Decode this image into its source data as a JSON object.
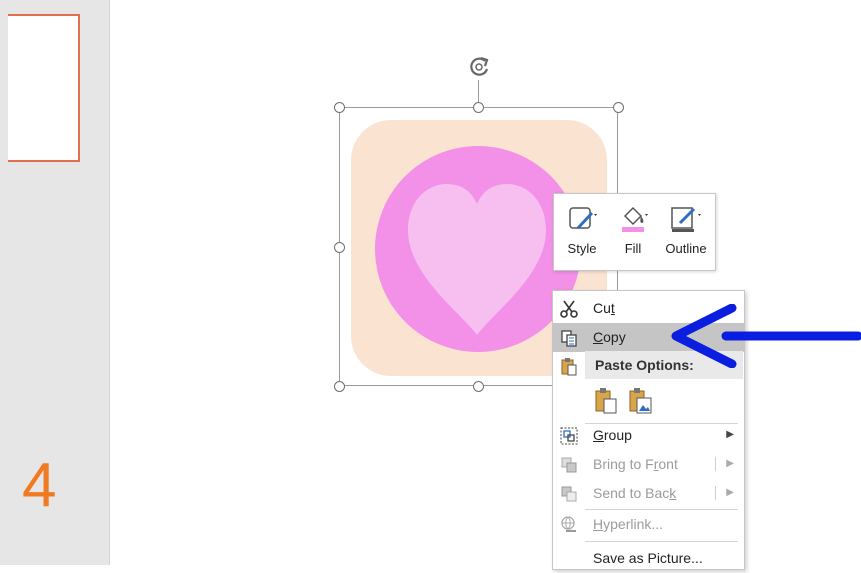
{
  "thumbnail": {
    "slide_number": "4"
  },
  "mini_toolbar": {
    "style_label": "Style",
    "fill_label": "Fill",
    "outline_label": "Outline"
  },
  "context_menu": {
    "cut": {
      "pre": "Cu",
      "key": "t",
      "post": ""
    },
    "copy": {
      "pre": "",
      "key": "C",
      "post": "opy"
    },
    "paste_options": "Paste Options:",
    "group": {
      "pre": "",
      "key": "G",
      "post": "roup"
    },
    "bring_to_front": {
      "pre": "Bring to F",
      "key": "r",
      "post": "ont"
    },
    "send_to_back": {
      "pre": "Send to Bac",
      "key": "k",
      "post": ""
    },
    "hyperlink": {
      "pre": "",
      "key": "H",
      "post": "yperlink..."
    },
    "save_as_picture": "Save as Picture..."
  },
  "icons": {
    "cut": "scissors-icon",
    "copy": "copy-icon",
    "paste": "paste-icon",
    "group": "group-icon",
    "bring_to_front": "bring-to-front-icon",
    "send_to_back": "send-to-back-icon",
    "hyperlink": "hyperlink-icon",
    "rotate": "rotate-icon"
  },
  "colors": {
    "accent_blue": "#0a1ee0",
    "tile_background": "#fbe3d2",
    "circle": "#f390e7",
    "heart": "#f6bff0",
    "slide_number": "#f07a22"
  }
}
